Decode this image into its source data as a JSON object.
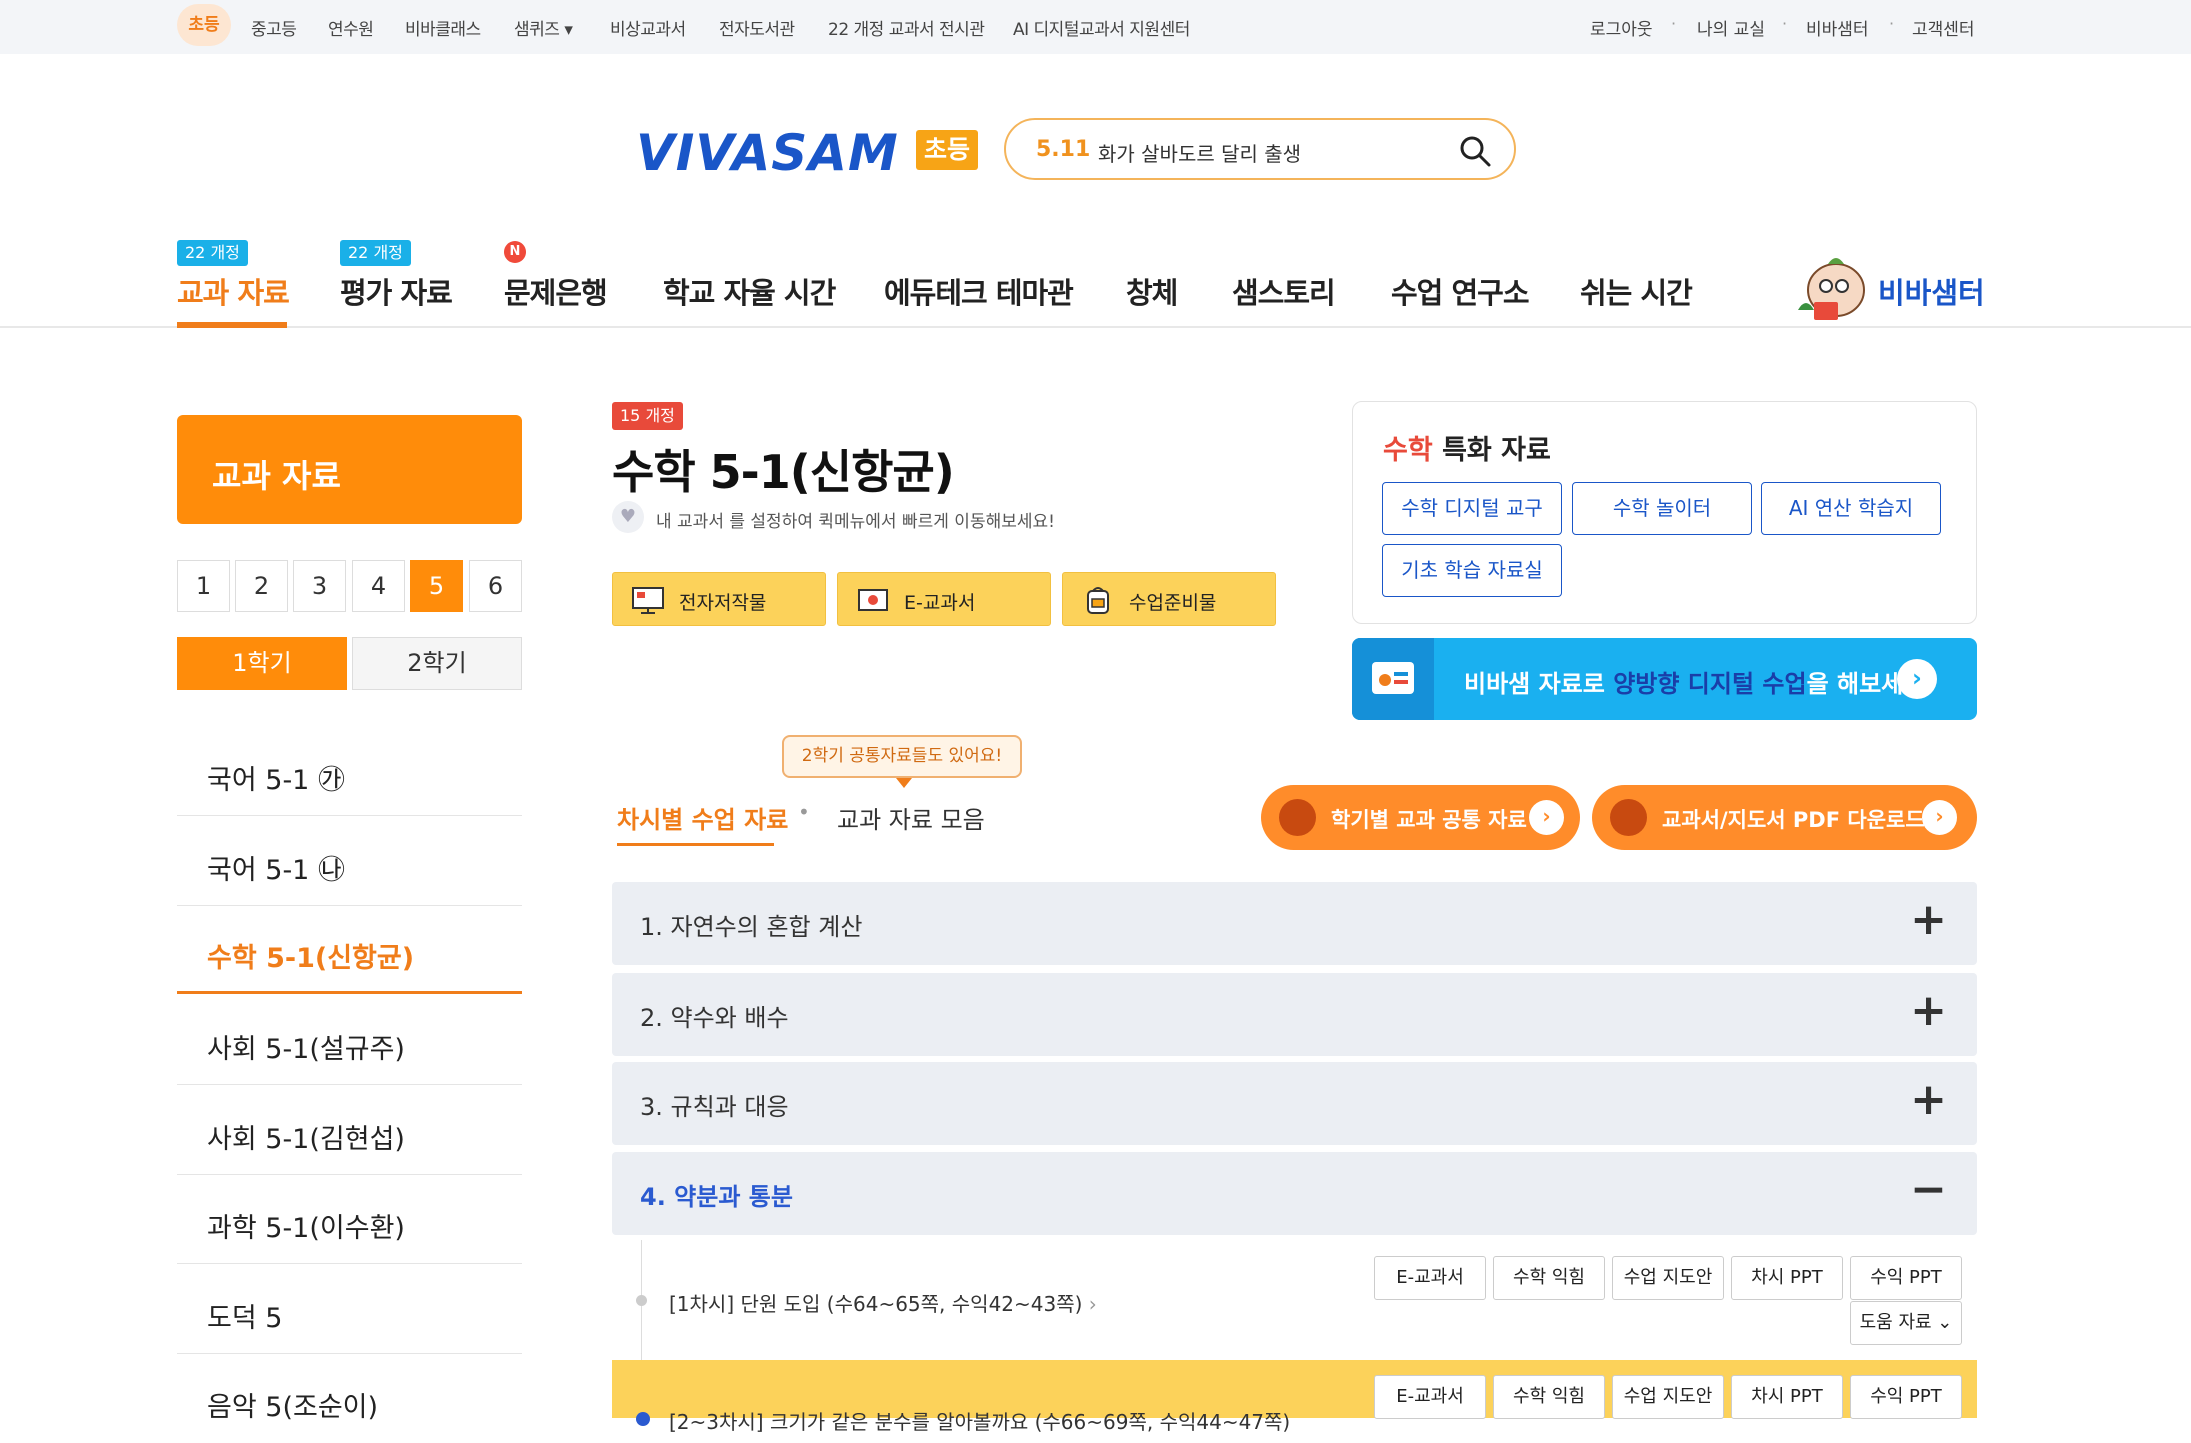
{
  "topnav": {
    "active": "초등",
    "links": [
      "중고등",
      "연수원",
      "비바클래스",
      "샘퀴즈",
      "비상교과서",
      "전자도서관",
      "22 개정 교과서 전시관",
      "AI 디지털교과서 지원센터"
    ],
    "right_links": [
      "로그아웃",
      "나의 교실",
      "비바샘터",
      "고객센터"
    ]
  },
  "header": {
    "logo": "VIVASAM",
    "logo_badge": "초등",
    "search_num": "5.11",
    "search_text": "화가 살바도르 달리 출생"
  },
  "gnb": {
    "tags": [
      "22 개정",
      "22 개정"
    ],
    "new_badge": "N",
    "items": [
      "교과 자료",
      "평가 자료",
      "문제은행",
      "학교 자율 시간",
      "에듀테크 테마관",
      "창체",
      "샘스토리",
      "수업 연구소",
      "쉬는 시간"
    ],
    "vivasamter": "비바샘터"
  },
  "sidebar": {
    "title": "교과 자료",
    "grades": [
      "1",
      "2",
      "3",
      "4",
      "5",
      "6"
    ],
    "active_grade": "5",
    "semesters": [
      "1학기",
      "2학기"
    ],
    "subjects": [
      "국어 5-1 ㉮",
      "국어 5-1 ㉯",
      "수학 5-1(신항균)",
      "사회 5-1(설규주)",
      "사회 5-1(김현섭)",
      "과학 5-1(이수환)",
      "도덕 5",
      "음악 5(조순이)"
    ]
  },
  "book": {
    "revision_tag": "15 개정",
    "title": "수학 5-1(신항균)",
    "desc": "내 교과서 를 설정하여 퀵메뉴에서 빠르게 이동해보세요!",
    "buttons": [
      "전자저작물",
      "E-교과서",
      "수업준비물"
    ]
  },
  "special": {
    "title_prefix": "수학",
    "title_suffix": " 특화 자료",
    "buttons": [
      "수학 디지털 교구",
      "수학 놀이터",
      "AI 연산 학습지",
      "기초 학습 자료실"
    ]
  },
  "banner": {
    "pre": "비바샘 자료로 ",
    "highlight": "양방향 디지털 수업",
    "post": "을 해보세요."
  },
  "tabs": {
    "tooltip": "2학기 공통자료들도 있어요!",
    "tab1": "차시별 수업 자료",
    "tab2": "교과 자료 모음",
    "btn1": "학기별 교과 공통 자료",
    "btn2": "교과서/지도서 PDF 다운로드"
  },
  "units": [
    {
      "label": "1. 자연수의 혼합 계산",
      "sign": "+"
    },
    {
      "label": "2. 약수와 배수",
      "sign": "+"
    },
    {
      "label": "3. 규칙과 대응",
      "sign": "+"
    },
    {
      "label": "4. 약분과 통분",
      "sign": "−"
    }
  ],
  "lessons": [
    {
      "title": "[1차시] 단원 도입 (수64~65쪽, 수익42~43쪽)",
      "buttons": [
        "E-교과서",
        "수학 익힘",
        "수업 지도안",
        "차시 PPT",
        "수익 PPT"
      ],
      "extra": "도움 자료"
    },
    {
      "title": "[2~3차시] 크기가 같은 분수를 알아볼까요 (수66~69쪽, 수익44~47쪽)",
      "buttons": [
        "E-교과서",
        "수학 익힘",
        "수업 지도안",
        "차시 PPT",
        "수익 PPT"
      ]
    }
  ]
}
